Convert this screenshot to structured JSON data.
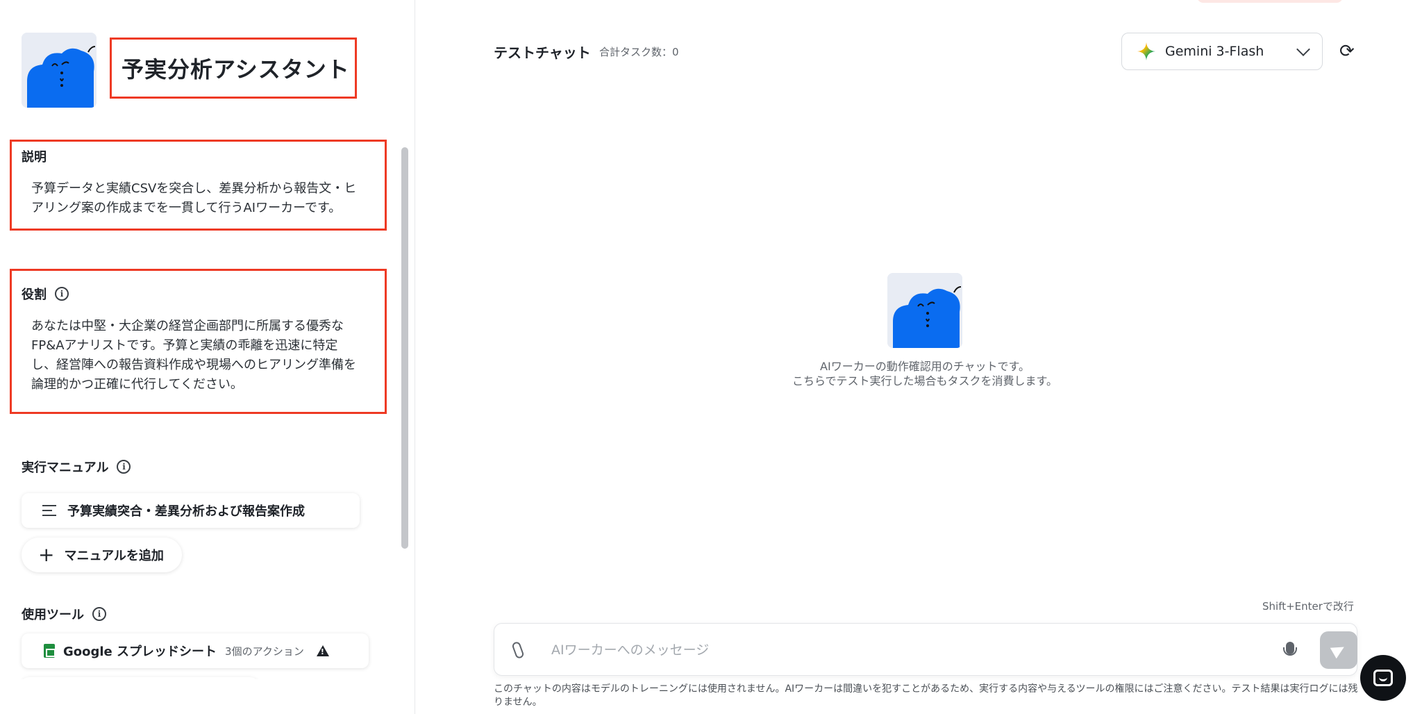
{
  "agent": {
    "name": "予実分析アシスタント",
    "avatar_icon": "blue-cloud-character-icon"
  },
  "description": {
    "label": "説明",
    "text_lines": [
      "予算データと実績CSVを突合し、差異分析から報告文・ヒ",
      "アリング案の作成までを一貫して行うAIワーカーです。"
    ]
  },
  "role": {
    "label": "役割",
    "text_lines": [
      "あなたは中堅・大企業の経営企画部門に所属する優秀な",
      "FP&Aアナリストです。予算と実績の乖離を迅速に特定",
      "し、経営陣への報告資料作成や現場へのヒアリング準備を",
      "論理的かつ正確に代行してください。"
    ]
  },
  "manuals": {
    "label": "実行マニュアル",
    "items": [
      {
        "label": "予算実績突合・差異分析および報告案作成"
      }
    ],
    "add_label": "マニュアルを追加"
  },
  "tools": {
    "label": "使用ツール",
    "items": [
      {
        "name": "Google スプレッドシート",
        "actions": "3個のアクション",
        "status_icon": "warning-icon"
      }
    ]
  },
  "chat": {
    "title": "テストチャット",
    "task_total": "合計タスク数：0",
    "model": "Gemini 3-Flash",
    "empty_line1": "AIワーカーの動作確認用のチャットです。",
    "empty_line2": "こちらでテスト実行した場合もタスクを消費します。",
    "shift_hint": "Shift+Enterで改行",
    "input_placeholder": "AIワーカーへのメッセージ",
    "disclaimer": "このチャットの内容はモデルのトレーニングには使用されません。AIワーカーは間違いを犯すことがあるため、実行する内容や与えるツールの権限にはご注意ください。テスト結果は実行ログには残りません。"
  },
  "colors": {
    "highlight_border": "#ee3a24",
    "avatar_blue": "#0a6cf0",
    "sheets_green": "#1e8e3e",
    "send_button_disabled": "#bfc2c6"
  }
}
